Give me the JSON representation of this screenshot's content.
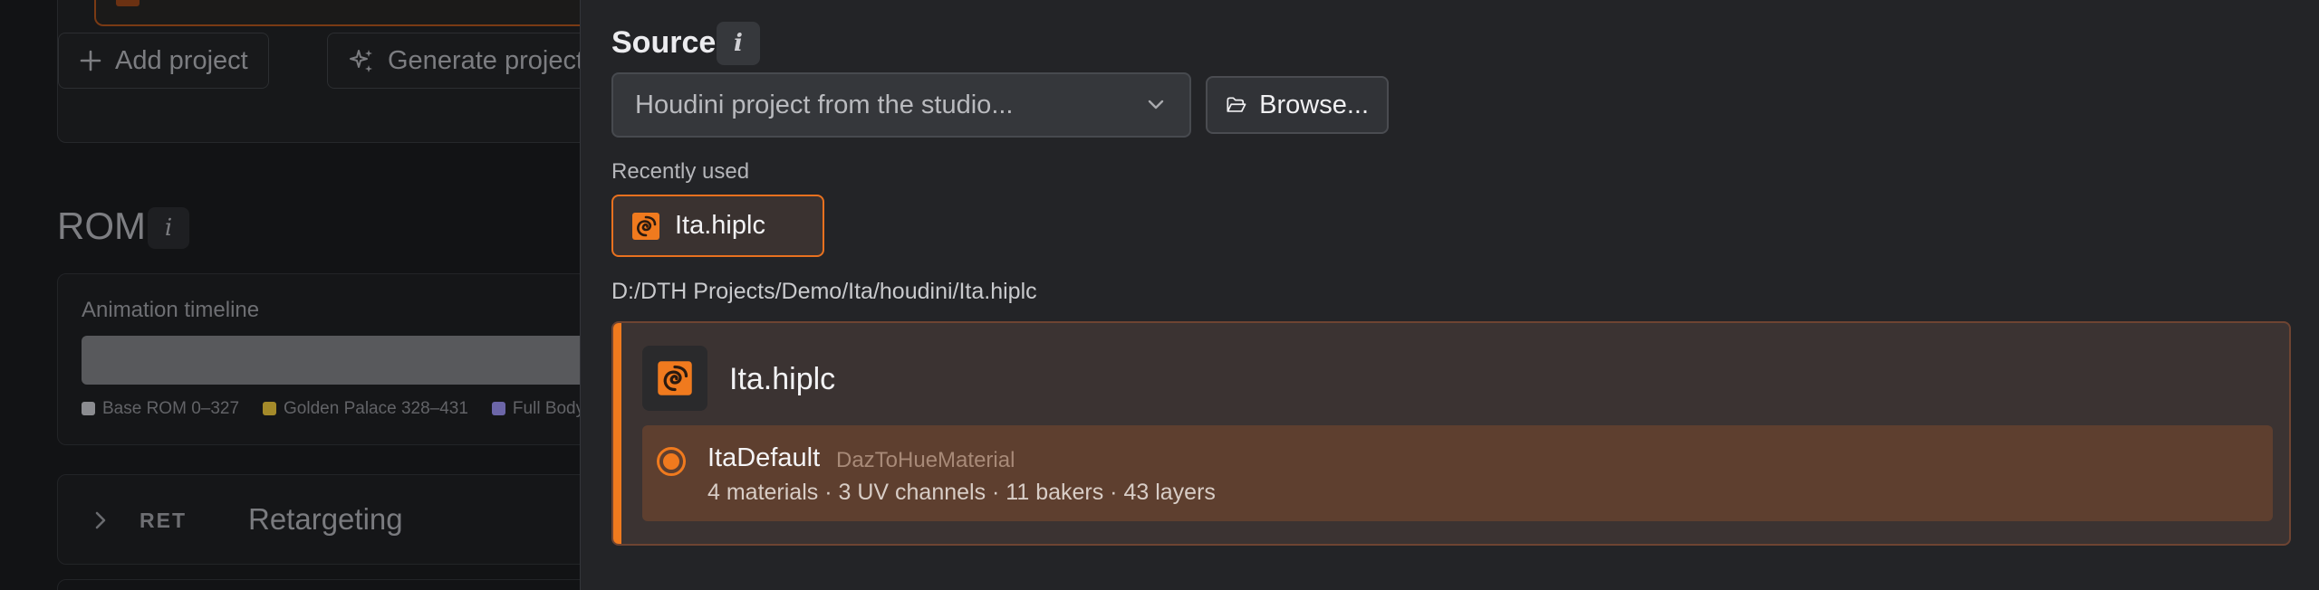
{
  "background": {
    "buttons": {
      "add_project": "Add project",
      "generate_project": "Generate project"
    },
    "rom": {
      "title": "ROM",
      "info": "i",
      "animation_timeline_label": "Animation timeline",
      "legend": [
        {
          "label": "Base ROM  0–327",
          "color": "#8b8c90"
        },
        {
          "label": "Golden Palace  328–431",
          "color": "#a48a2a"
        },
        {
          "label": "Full Body",
          "color": "#6c66a8"
        }
      ]
    },
    "retargeting": {
      "code": "RET",
      "name": "Retargeting"
    }
  },
  "source": {
    "title": "Source",
    "info": "i",
    "select_value": "Houdini project from the studio...",
    "browse_label": "Browse...",
    "recently_used_label": "Recently used",
    "recent_files": [
      {
        "name": "Ita.hiplc"
      }
    ],
    "selected_path": "D:/DTH Projects/Demo/Ita/houdini/Ita.hiplc",
    "selected_file": {
      "name": "Ita.hiplc",
      "options": [
        {
          "title": "ItaDefault",
          "subtitle": "DazToHueMaterial",
          "stats": "4 materials · 3 UV channels · 11 bakers · 43 layers",
          "selected": true
        }
      ]
    }
  },
  "colors": {
    "accent": "#f07a1e",
    "panel_bg": "#232427",
    "selected_option_bg": "#5e3f2f"
  }
}
